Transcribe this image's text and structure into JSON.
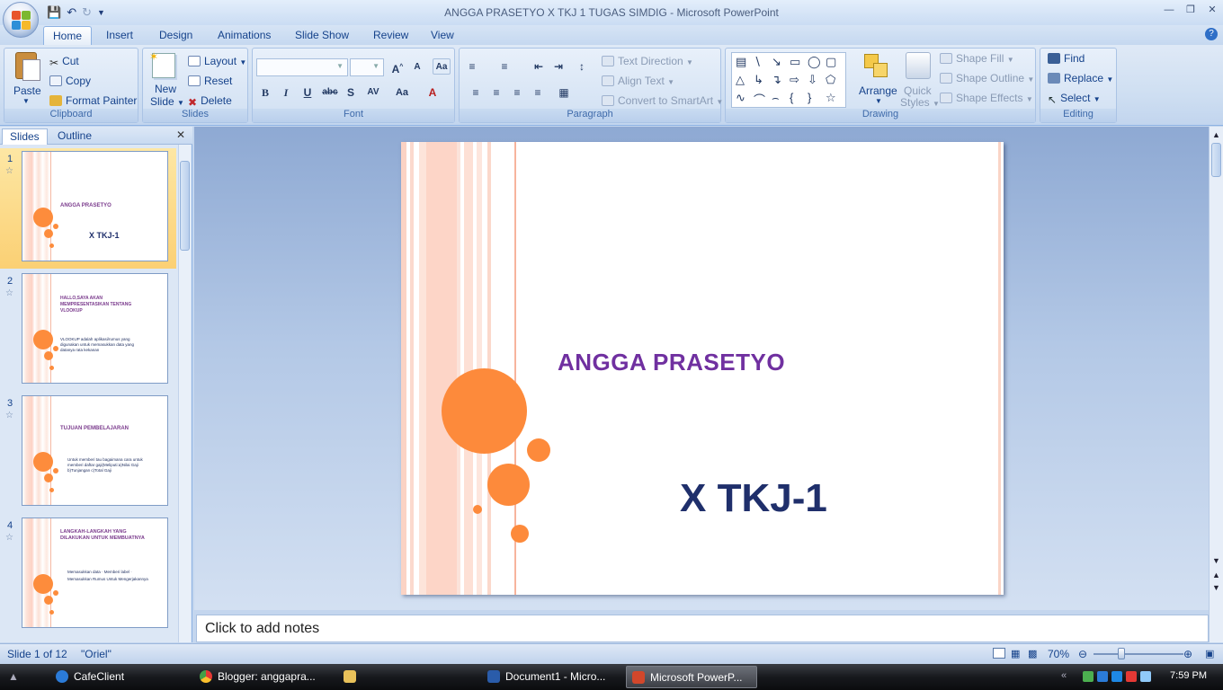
{
  "window": {
    "title": "ANGGA PRASETYO X TKJ 1 TUGAS SIMDIG - Microsoft PowerPoint"
  },
  "ribbon_tabs": [
    "Home",
    "Insert",
    "Design",
    "Animations",
    "Slide Show",
    "Review",
    "View"
  ],
  "ribbon": {
    "clipboard": {
      "paste": "Paste",
      "cut": "Cut",
      "copy": "Copy",
      "format_painter": "Format Painter",
      "label": "Clipboard"
    },
    "slides": {
      "new_slide_1": "New",
      "new_slide_2": "Slide",
      "layout": "Layout",
      "reset": "Reset",
      "delete": "Delete",
      "label": "Slides"
    },
    "font": {
      "label": "Font"
    },
    "paragraph": {
      "text_direction": "Text Direction",
      "align_text": "Align Text",
      "convert_smartart": "Convert to SmartArt",
      "label": "Paragraph"
    },
    "drawing": {
      "arrange": "Arrange",
      "quick_styles_1": "Quick",
      "quick_styles_2": "Styles",
      "shape_fill": "Shape Fill",
      "shape_outline": "Shape Outline",
      "shape_effects": "Shape Effects",
      "label": "Drawing"
    },
    "editing": {
      "find": "Find",
      "replace": "Replace",
      "select": "Select",
      "label": "Editing"
    }
  },
  "panel_tabs": {
    "slides": "Slides",
    "outline": "Outline"
  },
  "thumbnails": [
    {
      "num": "1",
      "title": "ANGGA PRASETYO",
      "body": "X TKJ-1"
    },
    {
      "num": "2",
      "title": "HALLO,SAYA AKAN MEMPRESENTASIKAN TENTANG VLOOKUP",
      "body": "VLOOKUP adalah aplikasi/rumus yang digunakan untuk memasukkan data yang datanya rata kekanan"
    },
    {
      "num": "3",
      "title": "TUJUAN PEMBELAJARAN",
      "body": "Untuk memberi tau bagaimana cara untuk memberi daftar gaji(Meliputi:a)Nilai Gaji b)Tunjangan c)Total Gaji"
    },
    {
      "num": "4",
      "title": "LANGKAH-LANGKAH YANG DILAKUKAN UNTUK MEMBUATNYA",
      "body": "Memasukkan data · Memberi label · Memasukkan Rumus Untuk Mengerjakannya"
    }
  ],
  "slide": {
    "title": "ANGGA PRASETYO",
    "subtitle": "X TKJ-1"
  },
  "notes": {
    "placeholder": "Click to add notes"
  },
  "status": {
    "slide_pos": "Slide 1 of 12",
    "theme": "\"Oriel\"",
    "zoom": "70%"
  },
  "taskbar": {
    "items": [
      "CafeClient",
      "Blogger: anggapra...",
      "",
      "Document1 - Micro...",
      "Microsoft PowerP..."
    ],
    "clock": "7:59 PM"
  },
  "colors": {
    "accent_orange": "#fd8a3b",
    "title_purple": "#7030a0",
    "subtitle_navy": "#1f2f6b"
  }
}
